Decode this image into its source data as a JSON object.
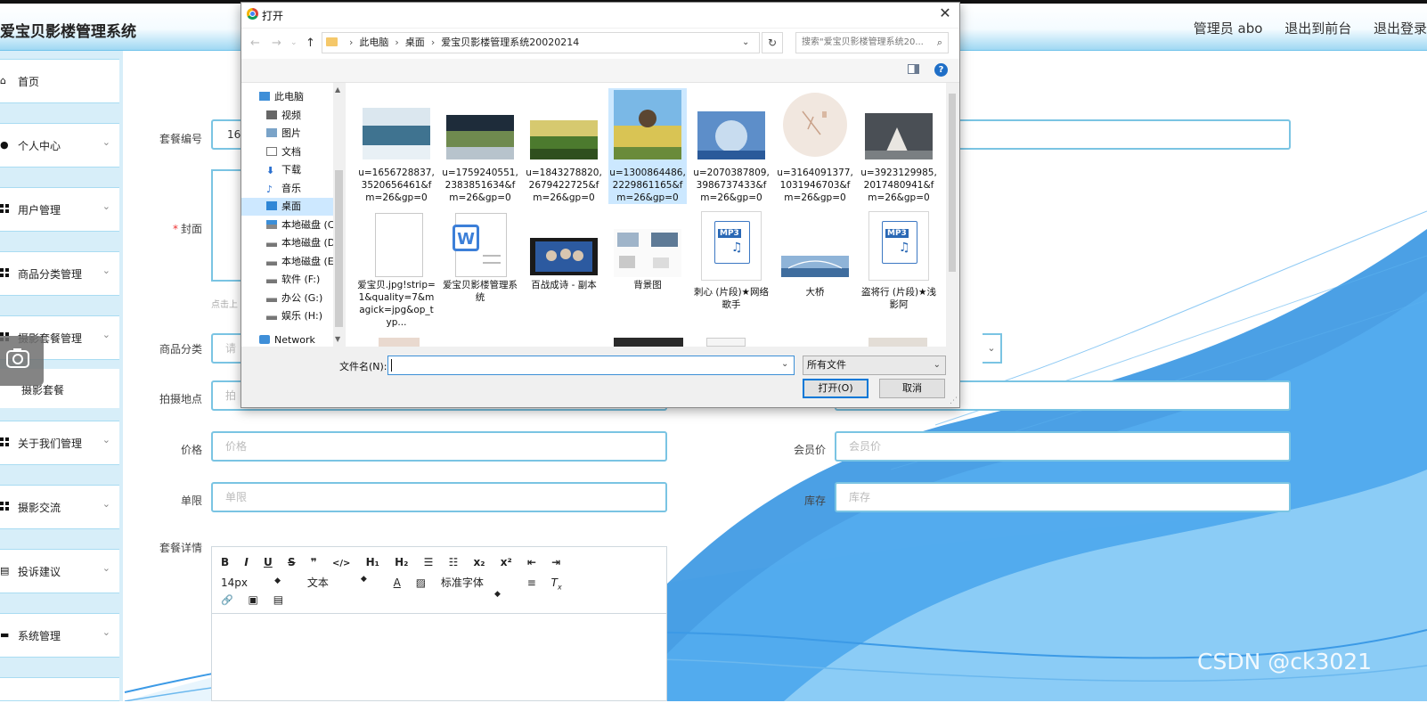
{
  "header": {
    "app_title": "爱宝贝影楼管理系统",
    "admin_label": "管理员 abo",
    "exit_front_label": "退出到前台",
    "logout_label": "退出登录"
  },
  "sidebar": {
    "items": [
      {
        "label": "首页",
        "icon": "home-icon",
        "has_chevron": false
      },
      {
        "label": "个人中心",
        "icon": "user-icon",
        "has_chevron": true
      },
      {
        "label": "用户管理",
        "icon": "grid-icon",
        "has_chevron": true
      },
      {
        "label": "商品分类管理",
        "icon": "grid-icon",
        "has_chevron": true
      },
      {
        "label": "摄影套餐管理",
        "icon": "grid-icon",
        "has_chevron": true
      },
      {
        "label": "关于我们管理",
        "icon": "grid-icon",
        "has_chevron": true
      },
      {
        "label": "摄影交流",
        "icon": "grid-icon",
        "has_chevron": true
      },
      {
        "label": "投诉建议",
        "icon": "print-icon",
        "has_chevron": true
      },
      {
        "label": "系统管理",
        "icon": "chat-icon",
        "has_chevron": true
      }
    ],
    "sub_item": "摄影套餐"
  },
  "form": {
    "package_no_label": "套餐编号",
    "package_no_value": "16",
    "cover_label": "封面",
    "cover_hint": "点击上",
    "category_label": "商品分类",
    "category_placeholder": "请",
    "location_label": "拍摄地点",
    "location_placeholder": "拍",
    "price_label": "价格",
    "price_placeholder": "价格",
    "member_price_label": "会员价",
    "member_price_placeholder": "会员价",
    "limit_label": "单限",
    "limit_placeholder": "单限",
    "stock_label": "库存",
    "stock_placeholder": "库存",
    "detail_label": "套餐详情"
  },
  "editor": {
    "row1": [
      "B",
      "I",
      "U",
      "S",
      "❞",
      "</>",
      "H₁",
      "H₂",
      "☰",
      "☷",
      "x₂",
      "x²",
      "⇤",
      "⇥"
    ],
    "font_size": "14px",
    "text_style": "文本",
    "font_family": "标准字体",
    "row3": [
      "🔗",
      "▣",
      "▤"
    ]
  },
  "dialog": {
    "title": "打开",
    "breadcrumb": [
      "此电脑",
      "桌面",
      "爱宝贝影楼管理系统20020214"
    ],
    "search_placeholder": "搜索\"爱宝贝影楼管理系统20...",
    "tree": [
      {
        "label": "此电脑",
        "level": 0
      },
      {
        "label": "视频",
        "level": 1
      },
      {
        "label": "图片",
        "level": 1
      },
      {
        "label": "文档",
        "level": 1
      },
      {
        "label": "下载",
        "level": 1
      },
      {
        "label": "音乐",
        "level": 1
      },
      {
        "label": "桌面",
        "level": 1,
        "selected": true
      },
      {
        "label": "本地磁盘 (C:",
        "level": 1
      },
      {
        "label": "本地磁盘 (D:",
        "level": 1
      },
      {
        "label": "本地磁盘 (E:",
        "level": 1
      },
      {
        "label": "软件 (F:)",
        "level": 1
      },
      {
        "label": "办公 (G:)",
        "level": 1
      },
      {
        "label": "娱乐 (H:)",
        "level": 1
      },
      {
        "label": "Network",
        "level": 0
      }
    ],
    "files_row1": [
      {
        "name": "u=1656728837,3520656461&fm=26&gp=0",
        "colors": [
          "#dbe7ef",
          "#3f7390",
          "#e8f0f5"
        ]
      },
      {
        "name": "u=1759240551,2383851634&fm=26&gp=0",
        "colors": [
          "#1e2c3a",
          "#6f8a4f",
          "#b7c3cc"
        ]
      },
      {
        "name": "u=1843278820,2679422725&fm=26&gp=0",
        "colors": [
          "#d6c96f",
          "#4c7a2e",
          "#2f4f1e"
        ]
      },
      {
        "name": "u=1300864486,2229861165&fm=26&gp=0",
        "colors": [
          "#7ab8e6",
          "#d9c454",
          "#6a8b3a"
        ],
        "selected": true
      },
      {
        "name": "u=2070387809,3986737433&fm=26&gp=0",
        "colors": [
          "#5d8ec9",
          "#c8dcef",
          "#2a5a9a"
        ]
      },
      {
        "name": "u=3164091377,1031946703&fm=26&gp=0",
        "colors": [
          "#f1e7df",
          "#d9b8a2",
          "#ffffff"
        ]
      },
      {
        "name": "u=3923129985,2017480941&fm=26&gp=0",
        "colors": [
          "#4a4f55",
          "#e9e6e1",
          "#7a7f82"
        ]
      }
    ],
    "files_row2": [
      {
        "name": "爱宝贝.jpg!strip=1&quality=7&magick=jpg&op_typ...",
        "kind": "blank"
      },
      {
        "name": "爱宝贝影楼管理系统",
        "kind": "word"
      },
      {
        "name": "百战成诗 - 副本",
        "kind": "film"
      },
      {
        "name": "背景图",
        "kind": "collage"
      },
      {
        "name": "刺心 (片段)★网络歌手",
        "kind": "mp3"
      },
      {
        "name": "大桥",
        "kind": "bridge"
      },
      {
        "name": "盗将行 (片段)★浅影阿",
        "kind": "mp3"
      }
    ],
    "filename_label": "文件名(N):",
    "filename_value": "",
    "filetype": "所有文件",
    "open_button": "打开(O)",
    "cancel_button": "取消"
  },
  "watermark": "CSDN @ck3021"
}
